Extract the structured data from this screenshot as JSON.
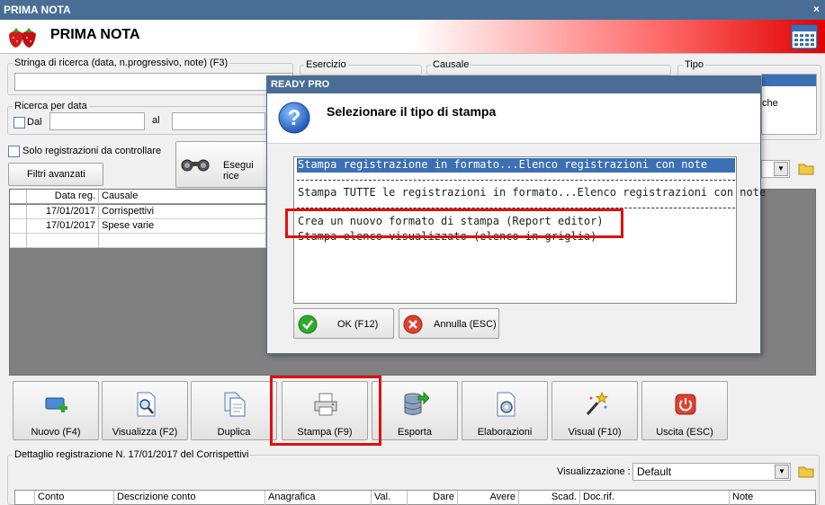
{
  "window": {
    "title": "PRIMA NOTA",
    "close": "×"
  },
  "header": {
    "title": "PRIMA NOTA",
    "logo_icon": "strawberry-logo-icon",
    "calendar_icon": "calendar-icon"
  },
  "search": {
    "stringa_label": "Stringa di ricerca (data, n.progressivo, note) (F3)",
    "stringa_value": "",
    "esercizio_label": "Esercizio",
    "causale_label": "Causale",
    "tipo_label": "Tipo",
    "tipo_value_partial": "che",
    "ricerca_data_label": "Ricerca per data",
    "dal_label": "Dal",
    "al_label": "al",
    "solo_label": "Solo registrazioni da controllare",
    "filtri_label": "Filtri avanzati",
    "esegui_label": "Esegui rice"
  },
  "grid": {
    "columns": [
      "Data reg.",
      "Causale"
    ],
    "rows": [
      {
        "date": "17/01/2017",
        "causale": "Corrispettivi"
      },
      {
        "date": "17/01/2017",
        "causale": "Spese varie"
      }
    ]
  },
  "toolbar": [
    {
      "label": "Nuovo (F4)",
      "icon": "new-record-icon"
    },
    {
      "label": "Visualizza (F2)",
      "icon": "view-document-icon"
    },
    {
      "label": "Duplica",
      "icon": "duplicate-icon"
    },
    {
      "label": "Stampa (F9)",
      "icon": "printer-icon"
    },
    {
      "label": "Esporta",
      "icon": "export-database-icon"
    },
    {
      "label": "Elaborazioni",
      "icon": "process-gear-icon"
    },
    {
      "label": "Visual (F10)",
      "icon": "magic-wand-icon"
    },
    {
      "label": "Uscita (ESC)",
      "icon": "power-exit-icon"
    }
  ],
  "detail": {
    "label": "Dettaglio registrazione N. 17/01/2017 del Corrispettivi",
    "visualizzazione_label": "Visualizzazione :",
    "visualizzazione_value": "Default",
    "columns": [
      "Conto",
      "Descrizione conto",
      "Anagrafica",
      "Val.",
      "Dare",
      "Avere",
      "Scad.",
      "Doc.rif.",
      "Note"
    ]
  },
  "modal": {
    "title": "READY PRO",
    "question": "Selezionare il tipo di stampa",
    "options": [
      "Stampa registrazione in formato...Elenco registrazioni con note",
      "Stampa TUTTE le registrazioni in formato...Elenco registrazioni con note",
      "Crea un nuovo formato di stampa (Report editor)",
      "Stampa elenco visualizzato (elenco in griglia)"
    ],
    "ok_label": "OK (F12)",
    "cancel_label": "Annulla (ESC)"
  },
  "colors": {
    "titlebar": "#4a6d95",
    "selection": "#3d6fb4",
    "highlight": "#e01010"
  }
}
